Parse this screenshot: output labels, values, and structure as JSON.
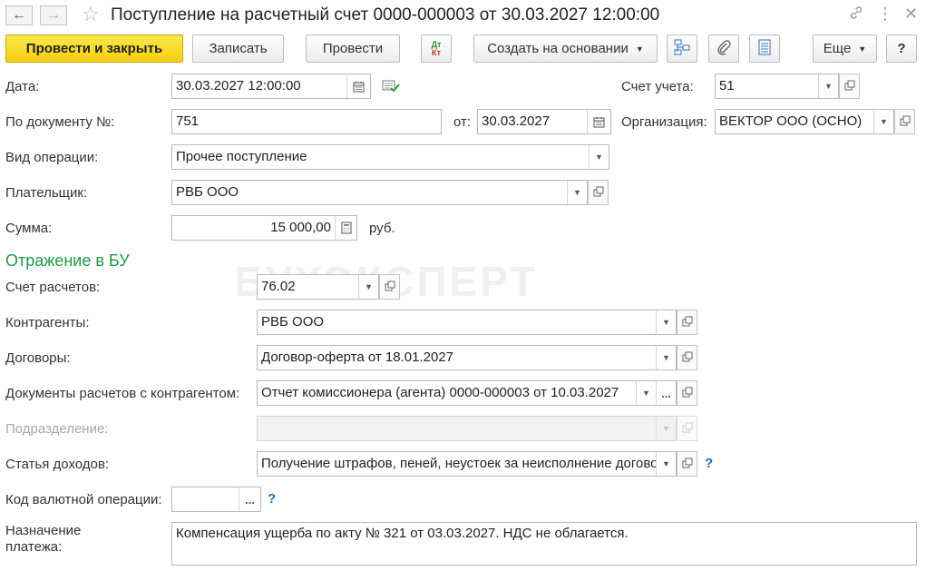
{
  "window": {
    "title": "Поступление на расчетный счет 0000-000003 от 30.03.2027 12:00:00"
  },
  "toolbar": {
    "post_close": "Провести и закрыть",
    "save": "Записать",
    "post": "Провести",
    "dtkt_top": "Дт",
    "dtkt_bottom": "Кт",
    "create_based": "Создать на основании",
    "more": "Еще",
    "help": "?"
  },
  "form": {
    "date_label": "Дата:",
    "date_value": "30.03.2027 12:00:00",
    "account_label": "Счет учета:",
    "account_value": "51",
    "docnum_label": "По документу №:",
    "docnum_value": "751",
    "from_label": "от:",
    "from_value": "30.03.2027",
    "org_label": "Организация:",
    "org_value": "ВЕКТОР ООО (ОСНО)",
    "optype_label": "Вид операции:",
    "optype_value": "Прочее поступление",
    "payer_label": "Плательщик:",
    "payer_value": "РВБ ООО",
    "amount_label": "Сумма:",
    "amount_value": "15 000,00",
    "currency": "руб."
  },
  "bu": {
    "section_title": "Отражение в БУ",
    "settle_account_label": "Счет расчетов:",
    "settle_account_value": "76.02",
    "counterparties_label": "Контрагенты:",
    "counterparties_value": "РВБ ООО",
    "contracts_label": "Договоры:",
    "contracts_value": "Договор-оферта от 18.01.2027",
    "settle_docs_label": "Документы расчетов с контрагентом:",
    "settle_docs_value": "Отчет комиссионера (агента) 0000-000003 от 10.03.2027",
    "subdivision_label": "Подразделение:",
    "subdivision_value": "",
    "income_item_label": "Статья доходов:",
    "income_item_value": "Получение штрафов, пеней, неустоек за неисполнение догово",
    "currency_code_label": "Код валютной операции:",
    "currency_code_value": "",
    "purpose_label_1": "Назначение",
    "purpose_label_2": "платежа:",
    "purpose_value": "Компенсация ущерба по акту № 321 от 03.03.2027. НДС не облагается.",
    "help": "?"
  },
  "watermark": "БУХЭКСПЕРТ",
  "colors": {
    "primary_button": "#f5ce12",
    "section_title": "#1f9a49",
    "help_link": "#1b6fc4"
  }
}
